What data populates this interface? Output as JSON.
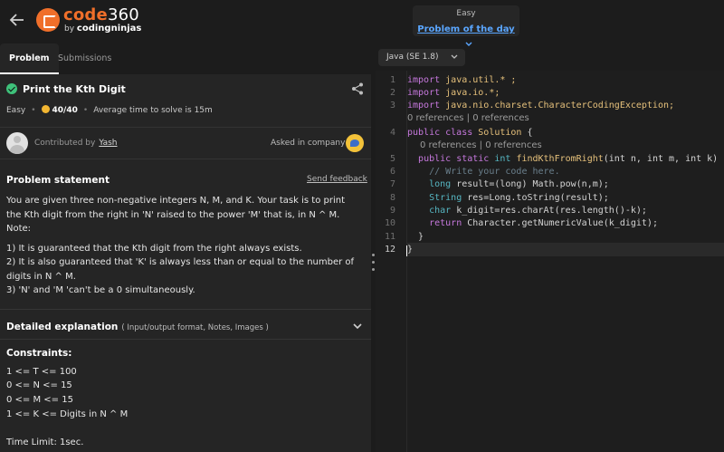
{
  "header": {
    "logo_code": "code",
    "logo_360": "360",
    "logo_by": "by",
    "logo_brand": "codingninjas",
    "difficulty": "Easy",
    "potd_link": "Problem of the day"
  },
  "tabs": {
    "problem": "Problem",
    "submissions": "Submissions"
  },
  "problem": {
    "title": "Print the Kth Digit",
    "difficulty": "Easy",
    "score": "40/40",
    "avg_time": "Average time to solve is 15m",
    "contributed_label": "Contributed by",
    "contributor": "Yash",
    "asked_label": "Asked in company",
    "statement_heading": "Problem statement",
    "send_feedback": "Send feedback",
    "statement_p1": "You are given three non-negative integers N, M, and K. Your task is to print the Kth digit from the right in 'N' raised to the power 'M' that is, in N ^ M.",
    "note": "Note:",
    "note1": "1) It is guaranteed that the Kth digit from the right always exists.",
    "note2": "2) It is also guaranteed that 'K' is always less than or equal to the number of digits in N ^ M.",
    "note3": "3) 'N' and 'M 'can't be a 0 simultaneously.",
    "detail_heading": "Detailed explanation",
    "detail_sub": "( Input/output format, Notes, Images )",
    "constraints_heading": "Constraints:",
    "constraints": [
      "1 <= T <= 100",
      "0 <= N <= 15",
      "0 <= M <= 15",
      "1 <= K <= Digits in N ^ M"
    ],
    "time_limit": "Time Limit: 1sec."
  },
  "editor": {
    "language": "Java (SE 1.8)",
    "line_numbers": [
      "1",
      "2",
      "3",
      "4",
      "5",
      "6",
      "7",
      "8",
      "9",
      "10",
      "11",
      "12"
    ],
    "lens": "0 references | 0 references",
    "lines": {
      "l1": "java.util.* ;",
      "l2": "java.io.*;",
      "l3": "java.nio.charset.CharacterCodingException;",
      "l4_class": "Solution",
      "l5_fn": "findKthFromRight",
      "l5_params": "(int n, int m, int k) {",
      "l6": "// Write your code here.",
      "l7": "result=(long) Math.pow(n,m);",
      "l8": "res=Long.toString(result);",
      "l9": "k_digit=res.charAt(res.length()-k);",
      "l10": "Character.getNumericValue(k_digit);",
      "l11": "}",
      "l12": "}"
    }
  },
  "colors": {
    "accent": "#f06f2a",
    "link": "#5aa6ff",
    "success": "#3ec17a",
    "coin": "#f2b632"
  }
}
